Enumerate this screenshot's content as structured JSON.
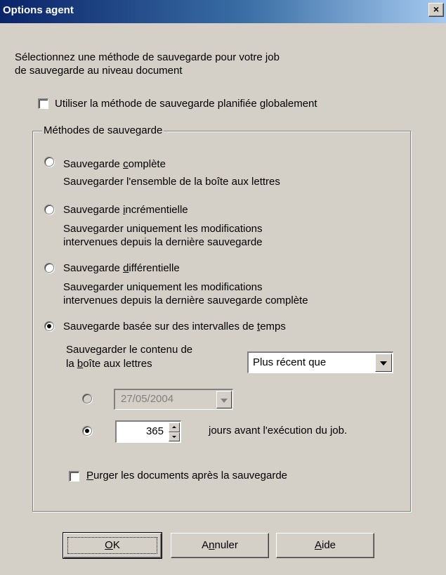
{
  "window": {
    "title": "Options agent",
    "close_glyph": "×"
  },
  "intro": {
    "line1": "Sélectionnez une méthode de sauvegarde pour votre job",
    "line2": "de sauvegarde au niveau document"
  },
  "global_checkbox": {
    "label_pre": "Utiliser la méthode de sauvegarde planifiée ",
    "label_u": "g",
    "label_post": "lobalement",
    "checked": false
  },
  "methods": {
    "legend": "Méthodes de sauvegarde",
    "complete": {
      "title_pre": "Sauvegarde ",
      "title_u": "c",
      "title_post": "omplète",
      "desc1": "Sauvegarder l'ensemble de la boîte aux lettres",
      "checked": false
    },
    "incremental": {
      "title_pre": "Sauvegarde ",
      "title_u": "i",
      "title_post": "ncrémentielle",
      "desc1": "Sauvegarder uniquement les modifications",
      "desc2": "intervenues depuis la dernière sauvegarde",
      "checked": false
    },
    "differential": {
      "title_pre": "Sauvegarde ",
      "title_u": "d",
      "title_post": "ifférentielle",
      "desc1": "Sauvegarder uniquement les modifications",
      "desc2": "intervenues depuis la dernière sauvegarde complète",
      "checked": false
    },
    "interval": {
      "title_pre": "Sauvegarde basée sur des intervalles de ",
      "title_u": "t",
      "title_post": "emps",
      "checked": true,
      "content_label1": "Sauvegarder le contenu de",
      "content_label2_pre": "la ",
      "content_label2_u": "b",
      "content_label2_post": "oîte aux lettres",
      "filter_selected": "Plus récent que",
      "date_value": "27/05/2004",
      "date_checked": false,
      "days_value": "365",
      "days_checked": true,
      "days_suffix": "jours avant l'exécution du job."
    }
  },
  "purge_checkbox": {
    "label_u": "P",
    "label_post": "urger les documents après la sauvegarde",
    "checked": false
  },
  "buttons": {
    "ok_u": "O",
    "ok_post": "K",
    "cancel_pre": "A",
    "cancel_u": "n",
    "cancel_post": "nuler",
    "help_u": "A",
    "help_post": "ide"
  }
}
